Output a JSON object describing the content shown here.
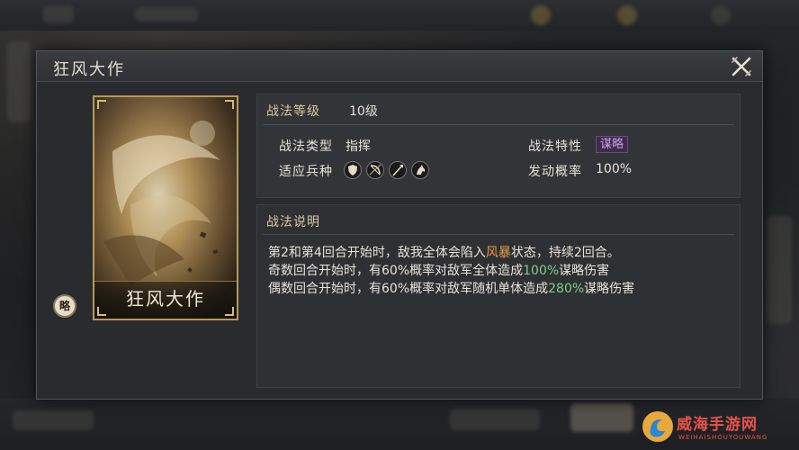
{
  "dialog": {
    "title": "狂风大作"
  },
  "card": {
    "name": "狂风大作",
    "type_badge": "略"
  },
  "attributes": {
    "level_label": "战法等级",
    "level_value": "10级",
    "type_label": "战法类型",
    "type_value": "指挥",
    "trait_label": "战法特性",
    "trait_value": "谋略",
    "units_label": "适应兵种",
    "units": [
      {
        "icon": "shield-icon"
      },
      {
        "icon": "bow-icon"
      },
      {
        "icon": "spear-icon"
      },
      {
        "icon": "horse-icon"
      }
    ],
    "chance_label": "发动概率",
    "chance_value": "100%"
  },
  "description": {
    "title": "战法说明",
    "line1": {
      "pre": "第2和第4回合开始时，敌我全体会陷入",
      "hl": "风暴",
      "post": "状态，持续2回合。"
    },
    "line2": {
      "pre": "奇数回合开始时，有60%概率对敌军全体造成",
      "hl": "100%",
      "post": "谋略伤害"
    },
    "line3": {
      "pre": "偶数回合开始时，有60%概率对敌军随机单体造成",
      "hl": "280%",
      "post": "谋略伤害"
    }
  },
  "watermark": {
    "text": "威海手游网",
    "sub": "WEIHAISHOUYOUWANG"
  },
  "colors": {
    "highlight_orange": "#e89a4e",
    "highlight_green": "#7bd08a",
    "trait_purple": "#c9a0e8",
    "card_gold": "#b89a55"
  }
}
